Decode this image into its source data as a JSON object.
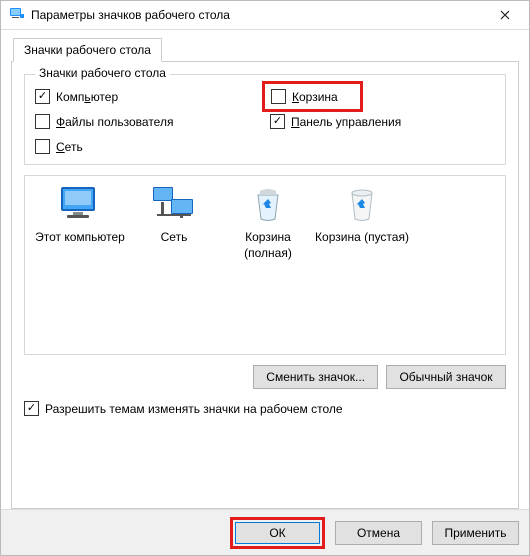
{
  "window": {
    "title": "Параметры значков рабочего стола"
  },
  "tab": {
    "label": "Значки рабочего стола"
  },
  "fieldset": {
    "legend": "Значки рабочего стола"
  },
  "checks": {
    "computer": {
      "label": "Компьютер",
      "checked": true
    },
    "recyclebin": {
      "label": "Корзина",
      "checked": false
    },
    "userfiles": {
      "label": "Файлы пользователя",
      "checked": false
    },
    "controlpanel": {
      "label": "Панель управления",
      "checked": true
    },
    "network": {
      "label": "Сеть",
      "checked": false
    }
  },
  "preview": {
    "items": [
      {
        "label": "Этот компьютер"
      },
      {
        "label": "Сеть"
      },
      {
        "label": "Корзина (полная)"
      },
      {
        "label": "Корзина (пустая)"
      }
    ]
  },
  "buttons": {
    "change": "Сменить значок...",
    "default": "Обычный значок"
  },
  "themecheck": {
    "label": "Разрешить темам изменять значки на рабочем столе",
    "checked": true
  },
  "footer": {
    "ok": "ОК",
    "cancel": "Отмена",
    "apply": "Применить"
  },
  "colors": {
    "highlight": "#e21b1b"
  }
}
